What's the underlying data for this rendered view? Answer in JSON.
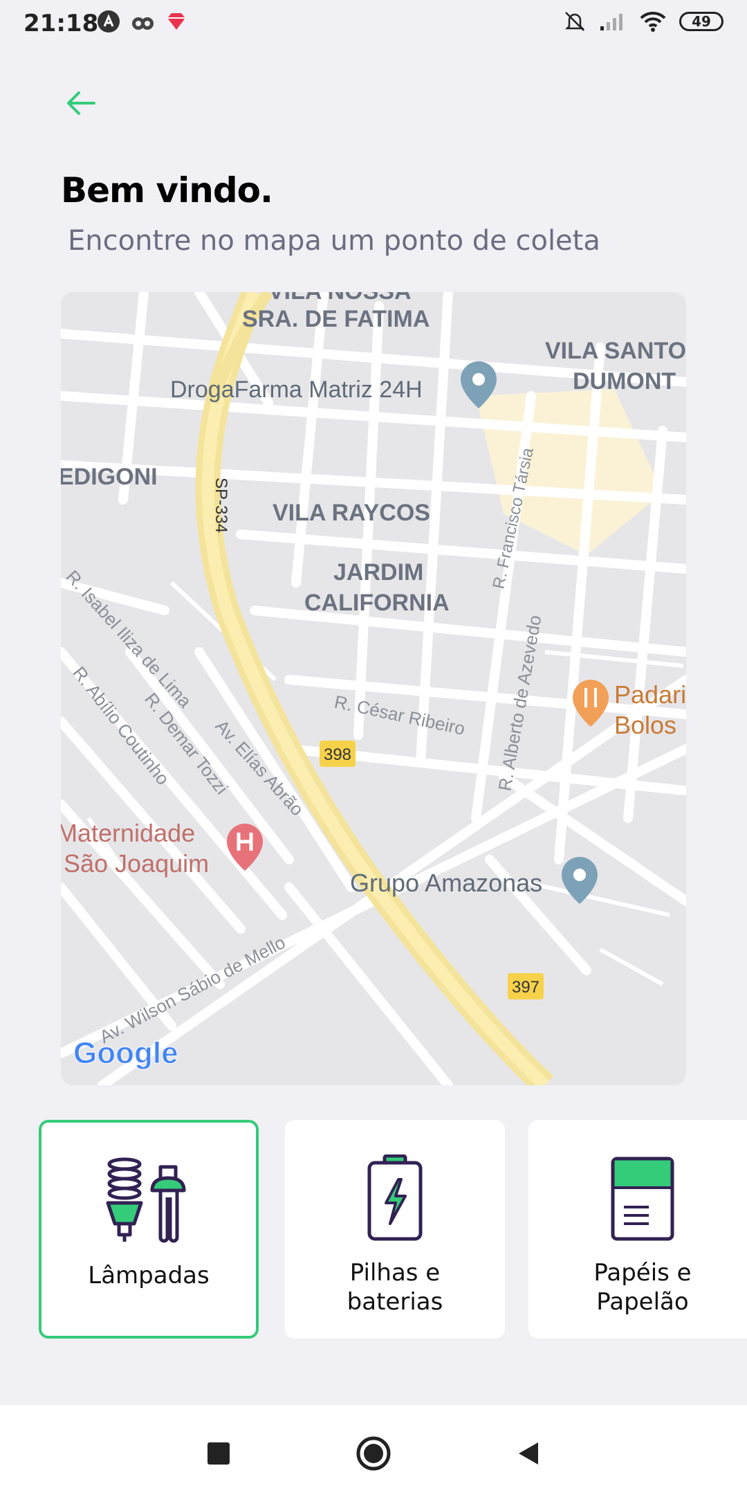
{
  "status_bar": {
    "time": "21:18",
    "battery": "49"
  },
  "header": {
    "back_icon": "arrow-left-icon",
    "title": "Bem vindo.",
    "subtitle": "Encontre no mapa um ponto de coleta"
  },
  "map": {
    "labels": {
      "vila_nossa": "VILA NOSSA",
      "sra_fatima": "SRA. DE FATIMA",
      "vila_santos": "VILA SANTO",
      "dumont": "DUMONT",
      "drogafarma": "DrogaFarma Matriz 24H",
      "edigoni": "EDIGONI",
      "sp334": "SP-334",
      "vila_raycos": "VILA RAYCOS",
      "jardim": "JARDIM",
      "california": "CALIFORNIA",
      "francisco": "R. Francisco Társia",
      "isabel": "R. Isabel Iliza de Lima",
      "abilio": "R. Abílio Coutinho",
      "demar": "R. Demar Tozzi",
      "elias": "Av. Elías Abrão",
      "cesar": "R. César Ribeiro",
      "alberto": "R. Alberto de Azevedo",
      "padaria": "Padari",
      "bolos": "Bolos",
      "r398": "398",
      "maternidade": "Maternidade",
      "sao_joaquim": "São Joaquim",
      "grupo": "Grupo Amazonas",
      "r397": "397",
      "wilson": "Av. Wilson Sábio de Mello",
      "google": "Google"
    }
  },
  "items": [
    {
      "label_line1": "Lâmpadas",
      "label_line2": "",
      "icon": "lamps-icon",
      "selected": true
    },
    {
      "label_line1": "Pilhas e",
      "label_line2": "baterias",
      "icon": "battery-icon",
      "selected": false
    },
    {
      "label_line1": "Papéis e",
      "label_line2": "Papelão",
      "icon": "paper-icon",
      "selected": false
    }
  ],
  "colors": {
    "accent": "#34cb79",
    "dark": "#322153",
    "background": "#f0f0f5"
  },
  "nav_bar": {
    "icons": [
      "recents-square-icon",
      "home-circle-icon",
      "back-triangle-icon"
    ]
  }
}
